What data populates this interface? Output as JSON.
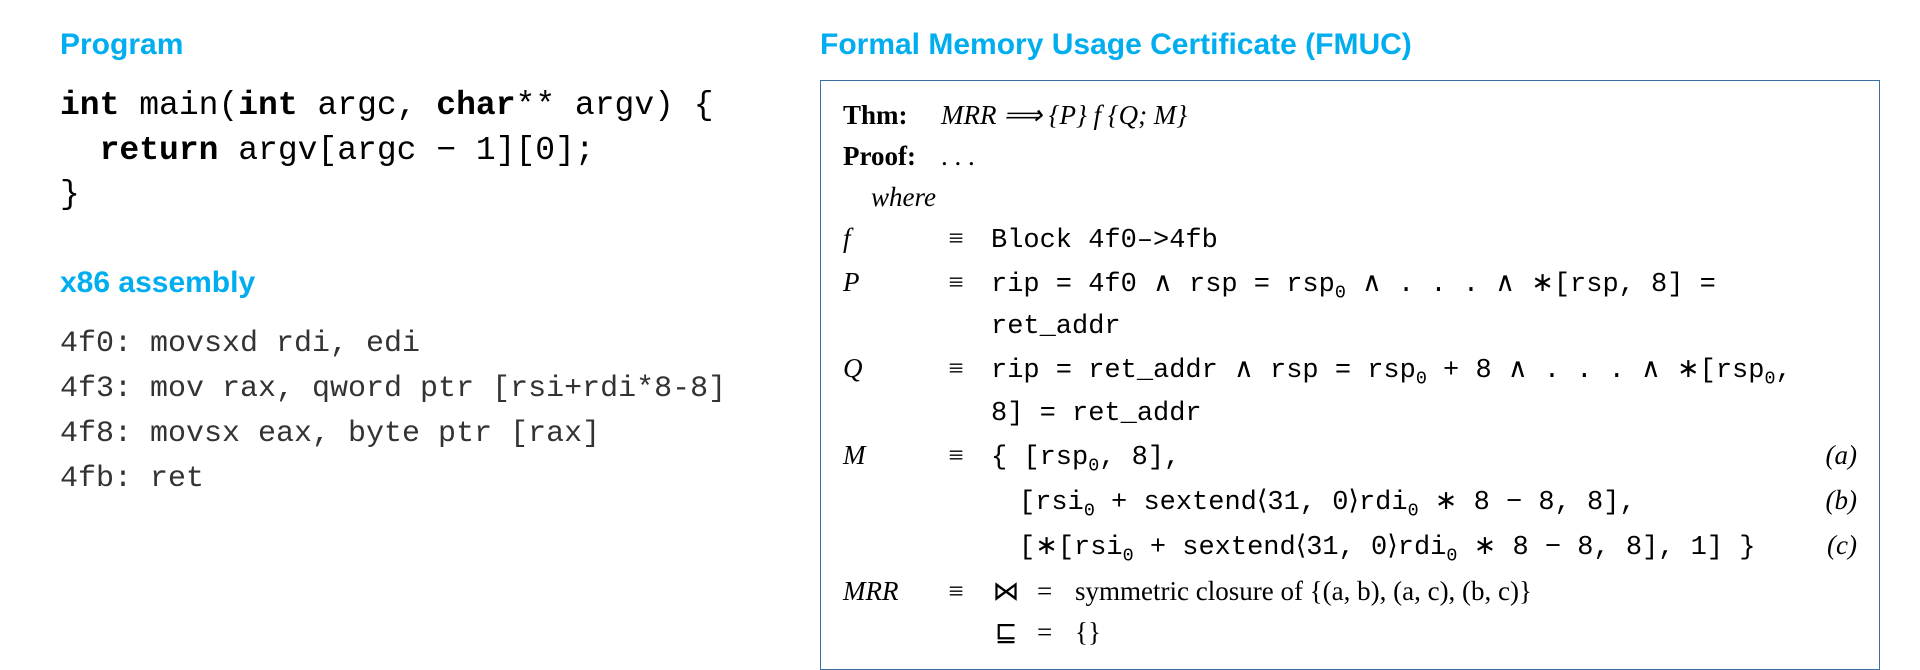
{
  "left": {
    "heading_program": "Program",
    "c_kw_int1": "int",
    "c_main": " main(",
    "c_kw_int2": "int",
    "c_argc": " argc, ",
    "c_kw_char": "char",
    "c_argv": "** argv) {",
    "c_indent": "  ",
    "c_kw_return": "return",
    "c_ret_body": " argv[argc − 1][0];",
    "c_close": "}",
    "heading_asm": "x86 assembly",
    "asm_l1": "4f0: movsxd rdi, edi",
    "asm_l2": "4f3: mov rax, qword ptr [rsi+rdi*8-8]",
    "asm_l3": "4f8: movsx eax, byte ptr [rax]",
    "asm_l4": "4fb: ret"
  },
  "right": {
    "heading_fmuc": "Formal Memory Usage Certificate (FMUC)",
    "thm_label": "Thm:",
    "thm_body": "MRR ⟹ {P} f {Q; M}",
    "proof_label": "Proof:",
    "proof_body": ". . .",
    "where_label": "where",
    "rows": {
      "f_lbl": "f",
      "P_lbl": "P",
      "Q_lbl": "Q",
      "M_lbl": "M",
      "MRR_lbl": "MRR",
      "equiv": "≡",
      "f_body": "Block 4f0–>4fb",
      "P_body_pre": "rip = 4f0 ∧ rsp = rsp",
      "P_body_post": " ∧ . . . ∧ ∗[rsp, 8] = ret_addr",
      "Q_body_pre": "rip = ret_addr ∧ rsp = rsp",
      "Q_body_mid": " + 8 ∧ . . . ∧ ∗[rsp",
      "Q_body_post": ", 8] = ret_addr",
      "M_line1_open": "{ [rsp",
      "M_line1_close": ", 8],",
      "M_line2_pre": "[rsi",
      "M_line2_mid": " + sextend⟨31, 0⟩rdi",
      "M_line2_post": " ∗ 8 − 8, 8],",
      "M_line3_pre": "[∗[rsi",
      "M_line3_mid": " + sextend⟨31, 0⟩rdi",
      "M_line3_post": " ∗ 8 − 8, 8], 1] }",
      "tag_a": "(a)",
      "tag_b": "(b)",
      "tag_c": "(c)",
      "bowtie": "⋈",
      "bowtie_body": "symmetric closure of {(a, b), (a, c), (b, c)}",
      "sqsub": "⊑",
      "sqsub_body": "{}",
      "eq": "=",
      "zero": "0"
    }
  }
}
